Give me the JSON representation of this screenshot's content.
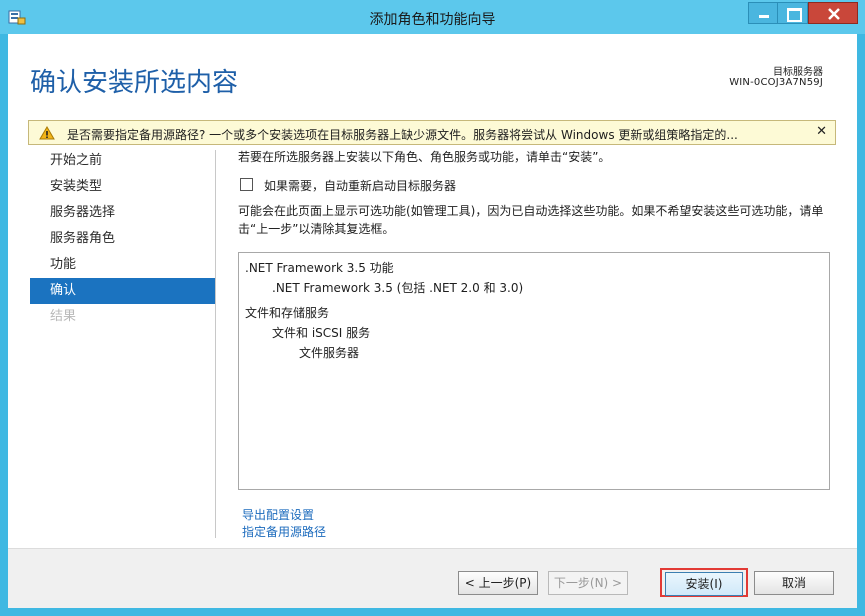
{
  "window": {
    "title": "添加角色和功能向导",
    "icon": "server-manager-icon"
  },
  "header": {
    "page_title": "确认安装所选内容",
    "target_label": "目标服务器",
    "target_name": "WIN-0COJ3A7N59J"
  },
  "warning": {
    "text": "是否需要指定备用源路径? 一个或多个安装选项在目标服务器上缺少源文件。服务器将尝试从 Windows 更新或组策略指定的...",
    "close_glyph": "✕"
  },
  "nav": {
    "items": [
      {
        "label": "开始之前",
        "state": "normal"
      },
      {
        "label": "安装类型",
        "state": "normal"
      },
      {
        "label": "服务器选择",
        "state": "normal"
      },
      {
        "label": "服务器角色",
        "state": "normal"
      },
      {
        "label": "功能",
        "state": "normal"
      },
      {
        "label": "确认",
        "state": "active"
      },
      {
        "label": "结果",
        "state": "disabled"
      }
    ]
  },
  "content": {
    "intro": "若要在所选服务器上安装以下角色、角色服务或功能，请单击“安装”。",
    "restart_label": "如果需要，自动重新启动目标服务器",
    "restart_checked": false,
    "notice": "可能会在此页面上显示可选功能(如管理工具)，因为已自动选择这些功能。如果不希望安装这些可选功能，请单击“上一步”以清除其复选框。",
    "features": [
      ".NET Framework 3.5 功能",
      ".NET Framework 3.5 (包括 .NET 2.0 和 3.0)",
      "文件和存储服务",
      "文件和 iSCSI 服务",
      "文件服务器"
    ],
    "export_link": "导出配置设置",
    "alt_source_link": "指定备用源路径"
  },
  "footer": {
    "prev_label": "< 上一步(P)",
    "next_label": "下一步(N) >",
    "install_label": "安装(I)",
    "cancel_label": "取消"
  },
  "colors": {
    "titlebar": "#5cc8ec",
    "accent": "#1b73c0",
    "page_title": "#1e5fa8",
    "link": "#1c6bbd",
    "highlight_border": "#e23a35"
  }
}
